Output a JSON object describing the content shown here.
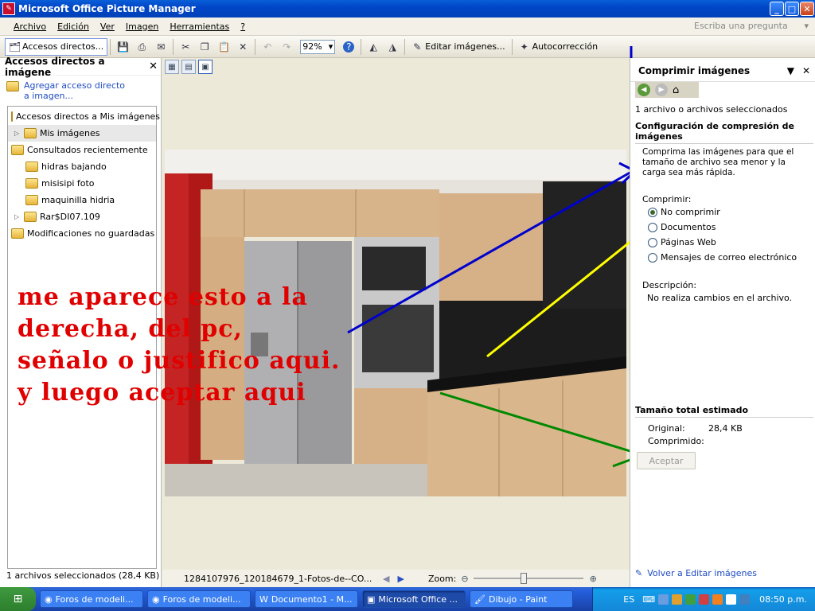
{
  "window": {
    "title": "Microsoft Office Picture Manager",
    "min": "_",
    "max": "□",
    "close": "✕"
  },
  "menu": {
    "items": [
      {
        "label": "Archivo"
      },
      {
        "label": "Edición"
      },
      {
        "label": "Ver"
      },
      {
        "label": "Imagen"
      },
      {
        "label": "Herramientas"
      },
      {
        "label": "?"
      }
    ],
    "ask_placeholder": "Escriba una pregunta"
  },
  "toolbar": {
    "shortcuts_label": "Accesos directos...",
    "zoom_value": "92%",
    "edit_images_label": "Editar imágenes...",
    "autocorrect_label": "Autocorrección"
  },
  "left_pane": {
    "title": "Accesos directos a imágene",
    "add_shortcut": "Agregar acceso directo a imagen...",
    "tree": [
      {
        "label": "Accesos directos a Mis imágenes",
        "level": 0,
        "icon": "shortcuts-folder-icon"
      },
      {
        "label": "Mis imágenes",
        "level": 1,
        "icon": "pictures-folder-icon",
        "expandable": true
      },
      {
        "label": "Consultados recientemente",
        "level": 0,
        "icon": "recent-folder-icon"
      },
      {
        "label": "hidras bajando",
        "level": 1,
        "icon": "folder-icon"
      },
      {
        "label": "misisipi foto",
        "level": 1,
        "icon": "folder-icon"
      },
      {
        "label": "maquinilla hidria",
        "level": 1,
        "icon": "folder-icon"
      },
      {
        "label": "Rar$DI07.109",
        "level": 1,
        "icon": "folder-icon",
        "expandable": true
      },
      {
        "label": "Modificaciones no guardadas",
        "level": 0,
        "icon": "unsaved-folder-icon"
      }
    ],
    "status": "1 archivos seleccionados (28,4 KB)"
  },
  "main": {
    "filename": "1284107976_120184679_1-Fotos-de--CO...",
    "zoom_label": "Zoom:",
    "zoom_level": 0.45,
    "annotation_lines": [
      "me aparece esto a la",
      "derecha, del pc,",
      "señalo o justifico aqui.",
      "y luego aceptar aqui"
    ]
  },
  "right_pane": {
    "title": "Comprimir imágenes",
    "selected_count": "1 archivo o archivos seleccionados",
    "section_title": "Configuración de compresión de imágenes",
    "description_intro": "Comprima las imágenes para que el tamaño de archivo sea menor y la carga sea más rápida.",
    "compress_label": "Comprimir:",
    "options": [
      {
        "label": "No comprimir",
        "selected": true
      },
      {
        "label": "Documentos",
        "selected": false
      },
      {
        "label": "Páginas Web",
        "selected": false
      },
      {
        "label": "Mensajes de correo electrónico",
        "selected": false
      }
    ],
    "description_label": "Descripción:",
    "description_text": "No realiza cambios en el archivo.",
    "estimate_title": "Tamaño total estimado",
    "original_label": "Original:",
    "original_value": "28,4 KB",
    "compressed_label": "Comprimido:",
    "ok_label": "Aceptar",
    "back_link": "Volver a Editar imágenes"
  },
  "taskbar": {
    "tasks": [
      {
        "label": "Foros de modeli...",
        "active": false
      },
      {
        "label": "Foros de modeli...",
        "active": false
      },
      {
        "label": "Documento1 - M...",
        "active": false
      },
      {
        "label": "Microsoft Office ...",
        "active": true
      },
      {
        "label": "Dibujo - Paint",
        "active": false
      }
    ],
    "lang": "ES",
    "clock": "08:50 p.m."
  },
  "colors": {
    "annotation_text": "#e00000",
    "arrow_blue": "#0000cc",
    "arrow_yellow": "#ffff00",
    "arrow_green": "#008800"
  }
}
